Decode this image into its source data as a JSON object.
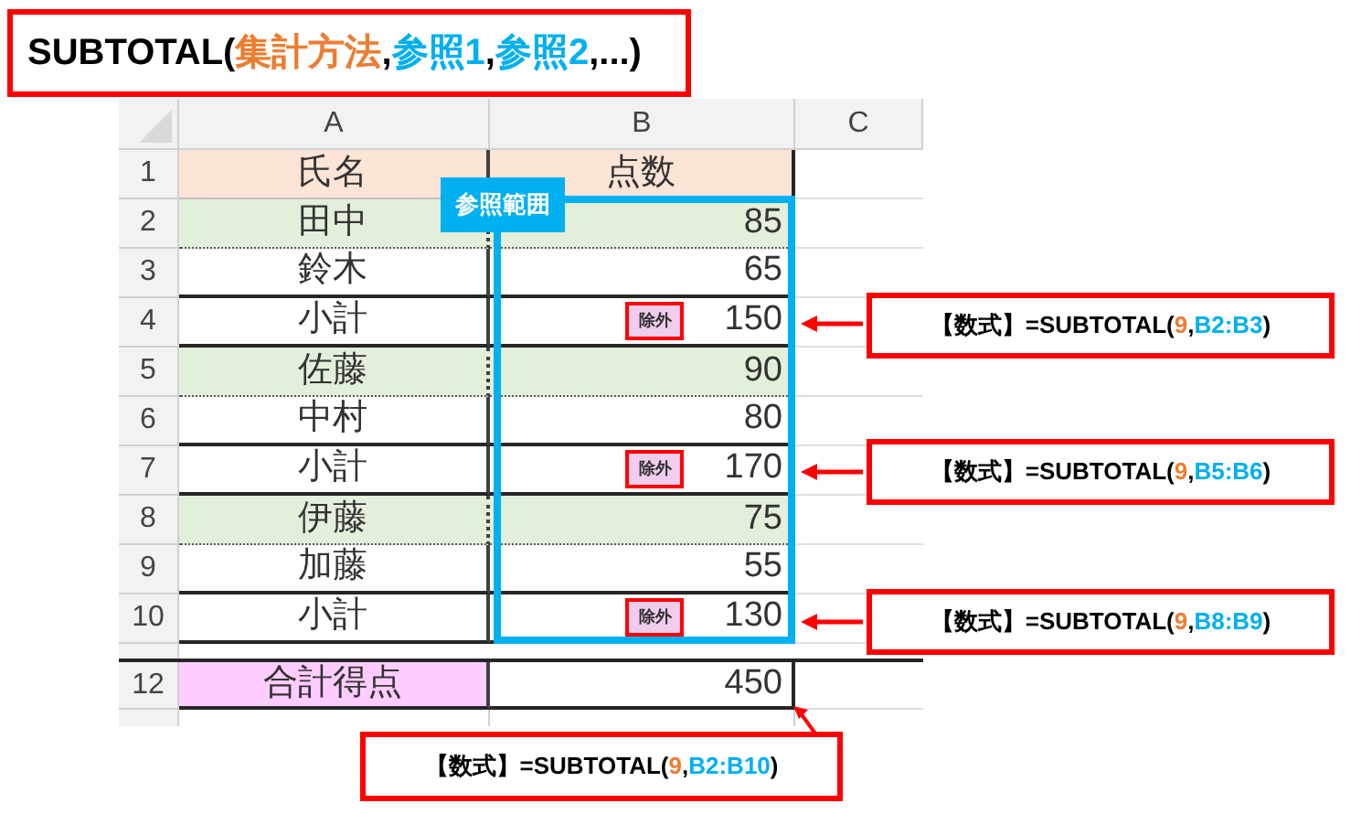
{
  "title": {
    "parts": [
      {
        "text": "SUBTOTAL(",
        "color": "#000000"
      },
      {
        "text": "集計方法",
        "color": "#ed7d31"
      },
      {
        "text": ",",
        "color": "#000000"
      },
      {
        "text": "参照1",
        "color": "#00b0f0"
      },
      {
        "text": ",",
        "color": "#000000"
      },
      {
        "text": "参照2",
        "color": "#00b0f0"
      },
      {
        "text": ",...)",
        "color": "#000000"
      }
    ]
  },
  "sheet": {
    "columns": [
      "A",
      "B",
      "C"
    ],
    "header_row": {
      "number": "1",
      "name_heading": "氏名",
      "score_heading": "点数",
      "color": "#fce4d6"
    },
    "rows": [
      {
        "number": "2",
        "name": "田中",
        "score": "85",
        "color": "#e2efda",
        "kind": "item"
      },
      {
        "number": "3",
        "name": "鈴木",
        "score": "65",
        "color": "#ffffff",
        "kind": "item"
      },
      {
        "number": "4",
        "name": "小計",
        "score": "150",
        "color": "#ffffff",
        "kind": "subtotal",
        "badge": "除外"
      },
      {
        "number": "5",
        "name": "佐藤",
        "score": "90",
        "color": "#e2efda",
        "kind": "item"
      },
      {
        "number": "6",
        "name": "中村",
        "score": "80",
        "color": "#ffffff",
        "kind": "item"
      },
      {
        "number": "7",
        "name": "小計",
        "score": "170",
        "color": "#ffffff",
        "kind": "subtotal",
        "badge": "除外"
      },
      {
        "number": "8",
        "name": "伊藤",
        "score": "75",
        "color": "#e2efda",
        "kind": "item"
      },
      {
        "number": "9",
        "name": "加藤",
        "score": "55",
        "color": "#ffffff",
        "kind": "item"
      },
      {
        "number": "10",
        "name": "小計",
        "score": "130",
        "color": "#ffffff",
        "kind": "subtotal",
        "badge": "除外"
      },
      {
        "number": "12",
        "name": "合計得点",
        "score": "450",
        "color": "#ffccff",
        "kind": "total"
      }
    ]
  },
  "range_label": "参照範囲",
  "callouts": [
    {
      "parts": [
        {
          "text": "【数式】",
          "color": "#000000"
        },
        {
          "text": "=SUBTOTAL(",
          "color": "#000000"
        },
        {
          "text": "9",
          "color": "#ed7d31"
        },
        {
          "text": ",",
          "color": "#000000"
        },
        {
          "text": "B2:B3",
          "color": "#00b0f0"
        },
        {
          "text": ")",
          "color": "#000000"
        }
      ]
    },
    {
      "parts": [
        {
          "text": "【数式】",
          "color": "#000000"
        },
        {
          "text": "=SUBTOTAL(",
          "color": "#000000"
        },
        {
          "text": "9",
          "color": "#ed7d31"
        },
        {
          "text": ",",
          "color": "#000000"
        },
        {
          "text": "B5:B6",
          "color": "#00b0f0"
        },
        {
          "text": ")",
          "color": "#000000"
        }
      ]
    },
    {
      "parts": [
        {
          "text": "【数式】",
          "color": "#000000"
        },
        {
          "text": "=SUBTOTAL(",
          "color": "#000000"
        },
        {
          "text": "9",
          "color": "#ed7d31"
        },
        {
          "text": ",",
          "color": "#000000"
        },
        {
          "text": "B8:B9",
          "color": "#00b0f0"
        },
        {
          "text": ")",
          "color": "#000000"
        }
      ]
    },
    {
      "parts": [
        {
          "text": "【数式】",
          "color": "#000000"
        },
        {
          "text": "=SUBTOTAL(",
          "color": "#000000"
        },
        {
          "text": "9",
          "color": "#ed7d31"
        },
        {
          "text": ",",
          "color": "#000000"
        },
        {
          "text": "B2:B10",
          "color": "#00b0f0"
        },
        {
          "text": ")",
          "color": "#000000"
        }
      ]
    }
  ]
}
